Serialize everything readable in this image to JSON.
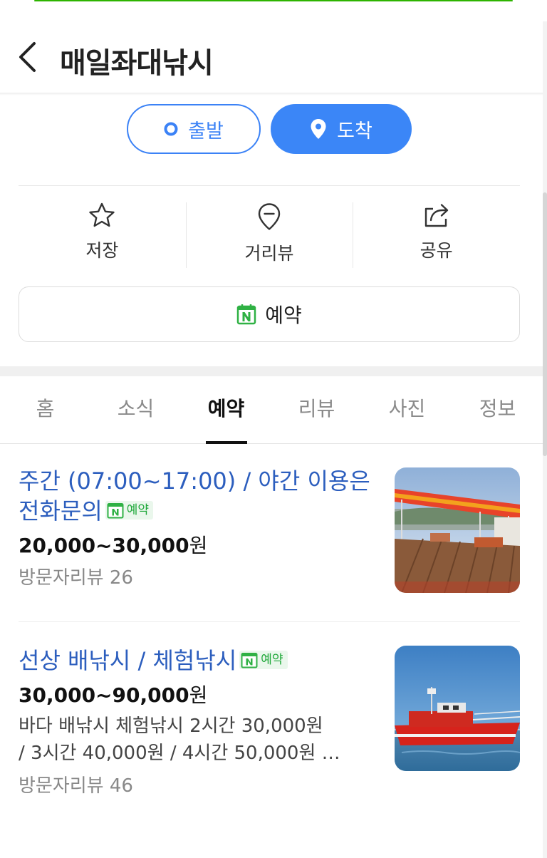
{
  "header": {
    "title": "매일좌대낚시",
    "back_icon": "chevron-left-icon"
  },
  "route": {
    "depart_label": "출발",
    "arrive_label": "도착",
    "accent_color": "#3b86f7"
  },
  "actions": [
    {
      "label": "저장",
      "icon": "star-icon"
    },
    {
      "label": "거리뷰",
      "icon": "street-view-icon"
    },
    {
      "label": "공유",
      "icon": "share-icon"
    }
  ],
  "reserve_button": {
    "label": "예약",
    "icon": "naver-booking-icon"
  },
  "tabs": [
    {
      "label": "홈",
      "active": false
    },
    {
      "label": "소식",
      "active": false
    },
    {
      "label": "예약",
      "active": true
    },
    {
      "label": "리뷰",
      "active": false
    },
    {
      "label": "사진",
      "active": false
    },
    {
      "label": "정보",
      "active": false
    }
  ],
  "items": [
    {
      "title": "주간 (07:00~17:00) / 야간 이용은 전화문의",
      "badge": "예약",
      "price": "20,000~30,000",
      "price_unit": "원",
      "description": "",
      "reviews": "방문자리뷰 26",
      "image": "floating-fishing-platform-photo"
    },
    {
      "title": "선상 배낚시 / 체험낚시",
      "badge": "예약",
      "price": "30,000~90,000",
      "price_unit": "원",
      "description_line1": "바다 배낚시 체험낚시 2시간 30,000원",
      "description_line2": "/ 3시간 40,000원 / 4시간 50,000원 …",
      "reviews": "방문자리뷰 46",
      "image": "red-fishing-boat-photo"
    }
  ]
}
